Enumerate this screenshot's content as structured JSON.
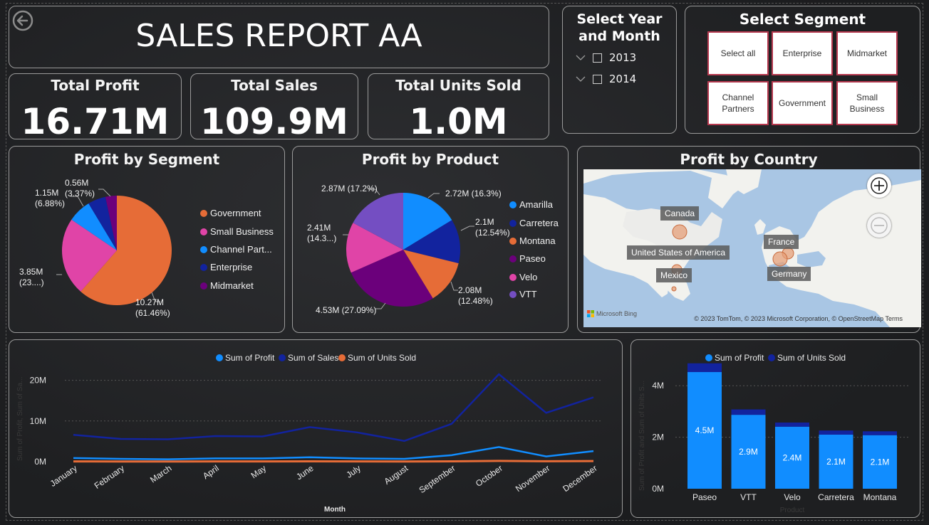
{
  "header": {
    "title": "SALES REPORT AA"
  },
  "kpis": {
    "profit": {
      "label": "Total Profit",
      "value": "16.71M"
    },
    "sales": {
      "label": "Total Sales",
      "value": "109.9M"
    },
    "units": {
      "label": "Total Units Sold",
      "value": "1.0M"
    }
  },
  "year_filter": {
    "title_line1": "Select Year",
    "title_line2": "and Month",
    "options": [
      "2013",
      "2014"
    ]
  },
  "segment_filter": {
    "title": "Select Segment",
    "tiles": [
      {
        "line1": "Select all",
        "line2": ""
      },
      {
        "line1": "Enterprise",
        "line2": ""
      },
      {
        "line1": "Midmarket",
        "line2": ""
      },
      {
        "line1": "Channel",
        "line2": "Partners"
      },
      {
        "line1": "Government",
        "line2": ""
      },
      {
        "line1": "Small",
        "line2": "Business"
      }
    ]
  },
  "profit_by_segment": {
    "title": "Profit by Segment",
    "legend": [
      "Government",
      "Small Business",
      "Channel Part...",
      "Enterprise",
      "Midmarket"
    ],
    "labels": {
      "government": [
        "10.27M",
        "(61.46%)"
      ],
      "small_business": [
        "3.85M",
        "(23....)"
      ],
      "channel": [
        "1.15M",
        "(6.88%)"
      ],
      "midmarket": [
        "0.56M",
        "(3.37%)"
      ]
    }
  },
  "profit_by_product": {
    "title": "Profit by Product",
    "legend": [
      "Amarilla",
      "Carretera",
      "Montana",
      "Paseo",
      "Velo",
      "VTT"
    ],
    "labels": {
      "amarilla": "2.72M (16.3%)",
      "carretera": [
        "2.1M",
        "(12.54%)"
      ],
      "montana": [
        "2.08M",
        "(12.48%)"
      ],
      "paseo": "4.53M (27.09%)",
      "velo": [
        "2.41M",
        "(14.3...)"
      ],
      "vtt": "2.87M (17.2%)"
    }
  },
  "profit_by_country": {
    "title": "Profit by Country",
    "countries": [
      "Canada",
      "United States of America",
      "Mexico",
      "France",
      "Germany"
    ],
    "bing": "Microsoft Bing",
    "attribution": "© 2023 TomTom, © 2023 Microsoft Corporation, © OpenStreetMap  Terms"
  },
  "chart_data": [
    {
      "type": "pie",
      "title": "Profit by Segment",
      "categories": [
        "Government",
        "Small Business",
        "Channel Partners",
        "Enterprise",
        "Midmarket"
      ],
      "values": [
        10.27,
        3.85,
        1.15,
        0.88,
        0.56
      ],
      "unit": "M",
      "colors": [
        "#e66c37",
        "#e044a7",
        "#118dff",
        "#12239e",
        "#6b007b"
      ]
    },
    {
      "type": "pie",
      "title": "Profit by Product",
      "categories": [
        "Amarilla",
        "Carretera",
        "Montana",
        "Paseo",
        "Velo",
        "VTT"
      ],
      "values": [
        2.72,
        2.1,
        2.08,
        4.53,
        2.41,
        2.87
      ],
      "unit": "M",
      "colors": [
        "#118dff",
        "#12239e",
        "#e66c37",
        "#6b007b",
        "#e044a7",
        "#744ec2"
      ]
    },
    {
      "type": "line",
      "xlabel": "Month",
      "ylabel": "Sum of Profit, Sum of Sa...",
      "categories": [
        "January",
        "February",
        "March",
        "April",
        "May",
        "June",
        "July",
        "August",
        "September",
        "October",
        "November",
        "December"
      ],
      "yticks": [
        "0M",
        "10M",
        "20M"
      ],
      "ylim": [
        0,
        25
      ],
      "series": [
        {
          "name": "Sum of Profit",
          "color": "#118dff",
          "values": [
            0.9,
            0.7,
            0.6,
            0.8,
            0.8,
            1.1,
            0.8,
            0.7,
            1.6,
            3.6,
            1.3,
            2.6
          ]
        },
        {
          "name": "Sum of Sales",
          "color": "#12239e",
          "values": [
            6.6,
            5.6,
            5.5,
            6.3,
            6.2,
            8.5,
            7.2,
            5.1,
            9.3,
            21.5,
            12.0,
            15.8
          ]
        },
        {
          "name": "Sum of Units Sold",
          "color": "#e66c37",
          "values": [
            0.06,
            0.05,
            0.05,
            0.06,
            0.06,
            0.08,
            0.07,
            0.05,
            0.09,
            0.2,
            0.11,
            0.15
          ]
        }
      ]
    },
    {
      "type": "bar",
      "stacked": true,
      "xlabel": "Product",
      "ylabel": "Sum of Profit and Sum of Units S...",
      "categories": [
        "Paseo",
        "VTT",
        "Velo",
        "Carretera",
        "Montana"
      ],
      "yticks": [
        "0M",
        "2M",
        "4M"
      ],
      "ylim": [
        0,
        5
      ],
      "series": [
        {
          "name": "Sum of Profit",
          "color": "#118dff",
          "values": [
            4.53,
            2.87,
            2.41,
            2.1,
            2.08
          ],
          "labels": [
            "4.5M",
            "2.9M",
            "2.4M",
            "2.1M",
            "2.1M"
          ]
        },
        {
          "name": "Sum of Units Sold",
          "color": "#12239e",
          "values": [
            0.34,
            0.21,
            0.16,
            0.16,
            0.15
          ]
        }
      ]
    }
  ]
}
